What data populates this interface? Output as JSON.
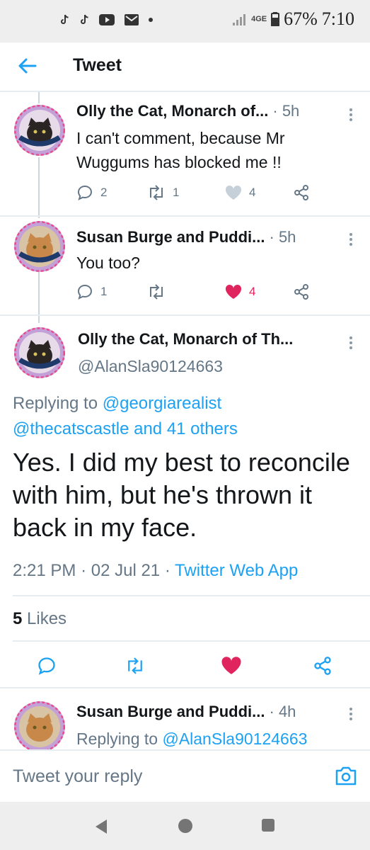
{
  "status_bar": {
    "network": "4GE",
    "battery": "67%",
    "time": "7:10",
    "icons": [
      "tiktok-icon",
      "tiktok-icon",
      "youtube-icon",
      "mail-icon",
      "dot-icon"
    ]
  },
  "header": {
    "title": "Tweet"
  },
  "tweets": [
    {
      "name": "Olly the Cat, Monarch of...",
      "time": "5h",
      "text": "I can't comment, because Mr Wuggums has blocked me !!",
      "replies": "2",
      "retweets": "1",
      "likes": "4",
      "liked": false
    },
    {
      "name": "Susan Burge and Puddi...",
      "time": "5h",
      "text": "You too?",
      "replies": "1",
      "retweets": "",
      "likes": "4",
      "liked": true
    }
  ],
  "main_tweet": {
    "name": "Olly the Cat, Monarch of Th...",
    "handle": "@AlanSla90124663",
    "replying_prefix": "Replying to",
    "replying_user": "@georgiarealist",
    "replying_others": "@thecatscastle and 41 others",
    "text": "Yes. I did my best to reconcile with him, but he's thrown it back in my face.",
    "time": "2:21 PM",
    "date": "02 Jul 21",
    "source": "Twitter Web App",
    "likes_count": "5",
    "likes_label": "Likes"
  },
  "reply_tweet": {
    "name": "Susan Burge and Puddi...",
    "time": "4h",
    "replying_prefix": "Replying to",
    "replying_user": "@AlanSla90124663"
  },
  "reply_bar": {
    "placeholder": "Tweet your reply"
  },
  "colors": {
    "accent": "#1da1f2",
    "like": "#e0245e",
    "muted": "#657786"
  }
}
